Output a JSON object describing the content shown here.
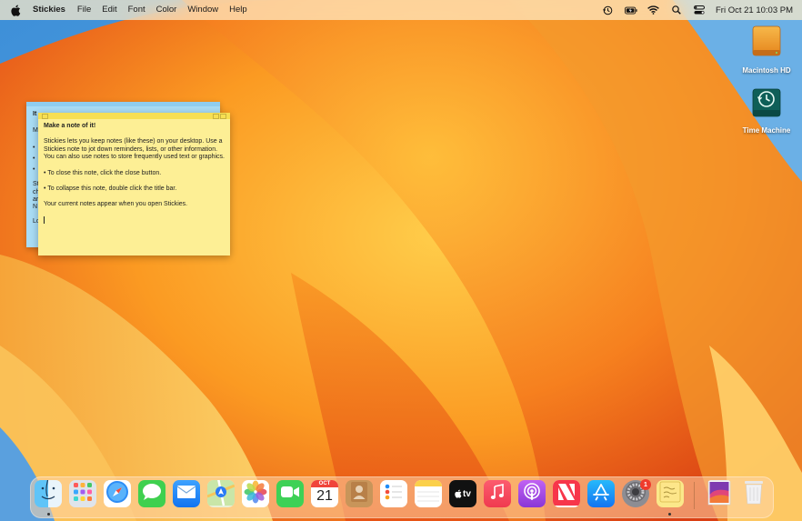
{
  "menubar": {
    "app_name": "Stickies",
    "menus": [
      "File",
      "Edit",
      "Font",
      "Color",
      "Window",
      "Help"
    ],
    "clock": "Fri Oct 21  10:03 PM"
  },
  "desktop_icons": [
    {
      "label": "Macintosh HD",
      "icon": "hard-drive-icon"
    },
    {
      "label": "Time Machine",
      "icon": "time-machine-icon"
    }
  ],
  "notes": {
    "blue": {
      "color": "#a9dcf5",
      "peek_lines": [
        "It",
        "M",
        "•",
        "•",
        "•",
        "St",
        "ch",
        "ar",
        "N",
        "Lo"
      ]
    },
    "yellow": {
      "color": "#fdef95",
      "heading": "Make a note of it!",
      "para1": "Stickies lets you keep notes (like these) on your desktop. Use a Stickies note to jot down reminders, lists, or other information. You can also use notes to store frequently used text or graphics.",
      "para2": "• To close this note, click the close button.",
      "para3": "• To collapse this note, double click the title bar.",
      "para4": "Your current notes appear when you open Stickies."
    }
  },
  "dock": {
    "items": [
      {
        "name": "finder",
        "icon": "finder-icon"
      },
      {
        "name": "launchpad",
        "icon": "launchpad-icon"
      },
      {
        "name": "safari",
        "icon": "safari-icon"
      },
      {
        "name": "messages",
        "icon": "messages-icon"
      },
      {
        "name": "mail",
        "icon": "mail-icon"
      },
      {
        "name": "maps",
        "icon": "maps-icon"
      },
      {
        "name": "photos",
        "icon": "photos-icon"
      },
      {
        "name": "facetime",
        "icon": "facetime-icon"
      },
      {
        "name": "calendar",
        "icon": "calendar-icon",
        "month": "OCT",
        "day": "21"
      },
      {
        "name": "contacts",
        "icon": "contacts-icon"
      },
      {
        "name": "reminders",
        "icon": "reminders-icon"
      },
      {
        "name": "notes",
        "icon": "notes-icon"
      },
      {
        "name": "apple-tv",
        "icon": "tv-icon",
        "text": "tv"
      },
      {
        "name": "music",
        "icon": "music-icon"
      },
      {
        "name": "podcasts",
        "icon": "podcasts-icon"
      },
      {
        "name": "news",
        "icon": "news-icon"
      },
      {
        "name": "app-store",
        "icon": "app-store-icon"
      },
      {
        "name": "system-settings",
        "icon": "gear-icon",
        "badge": "1"
      },
      {
        "name": "stickies",
        "icon": "stickies-icon"
      },
      {
        "name": "downloads-stack",
        "icon": "folder-stack-icon"
      },
      {
        "name": "trash",
        "icon": "trash-icon"
      }
    ]
  }
}
